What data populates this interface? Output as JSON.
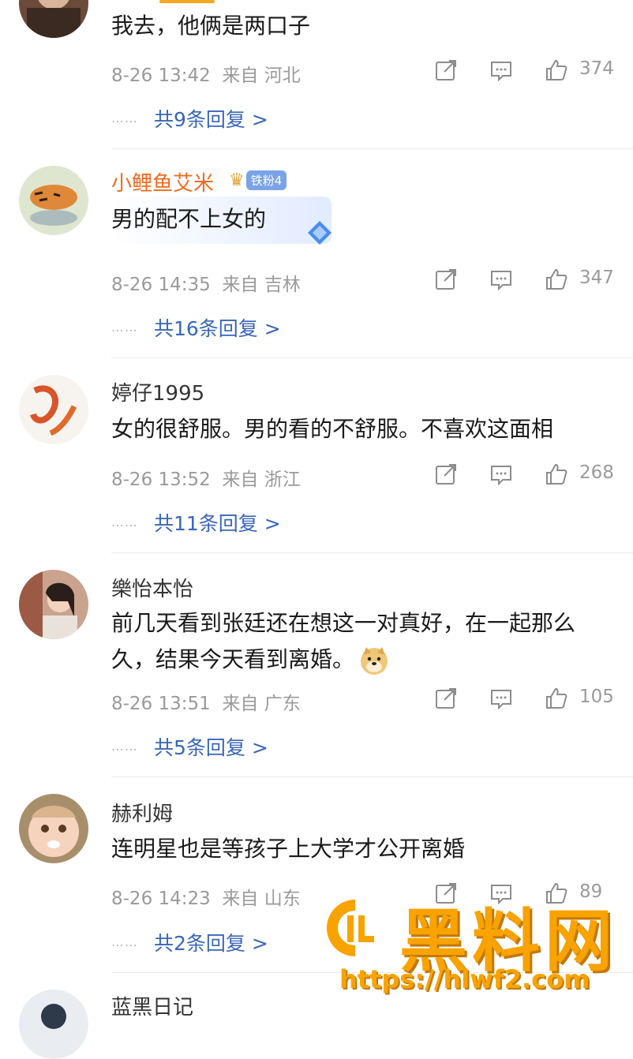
{
  "comments": [
    {
      "username": "",
      "text": "我去，他俩是两口子",
      "date": "8-26 13:42",
      "source": "来自 河北",
      "likes": "374",
      "replies": "共9条回复 >"
    },
    {
      "username": "小鲤鱼艾米",
      "badge": "铁粉4",
      "text": "男的配不上女的",
      "date": "8-26 14:35",
      "source": "来自 吉林",
      "likes": "347",
      "replies": "共16条回复 >"
    },
    {
      "username": "婷仔1995",
      "text": "女的很舒服。男的看的不舒服。不喜欢这面相",
      "date": "8-26 13:52",
      "source": "来自 浙江",
      "likes": "268",
      "replies": "共11条回复 >"
    },
    {
      "username": "樂怡本怡",
      "text": "前几天看到张廷还在想这一对真好，在一起那么久，结果今天看到离婚。",
      "date": "8-26 13:51",
      "source": "来自 广东",
      "likes": "105",
      "replies": "共5条回复 >"
    },
    {
      "username": "赫利姆",
      "text": "连明星也是等孩子上大学才公开离婚",
      "date": "8-26 14:23",
      "source": "来自 山东",
      "likes": "89",
      "replies": "共2条回复 >"
    },
    {
      "username": "蓝黑日记"
    }
  ],
  "dots": "⋯⋯",
  "icons": [
    "repost-icon",
    "comment-icon",
    "like-icon"
  ],
  "watermark": {
    "title": "黑料网",
    "url": "https://hlwf2.com"
  },
  "colors": {
    "reply_link": "#3a66b8",
    "vip_name": "#f26b1d",
    "meta": "#9a9a9a",
    "watermark": "#f8a300"
  }
}
